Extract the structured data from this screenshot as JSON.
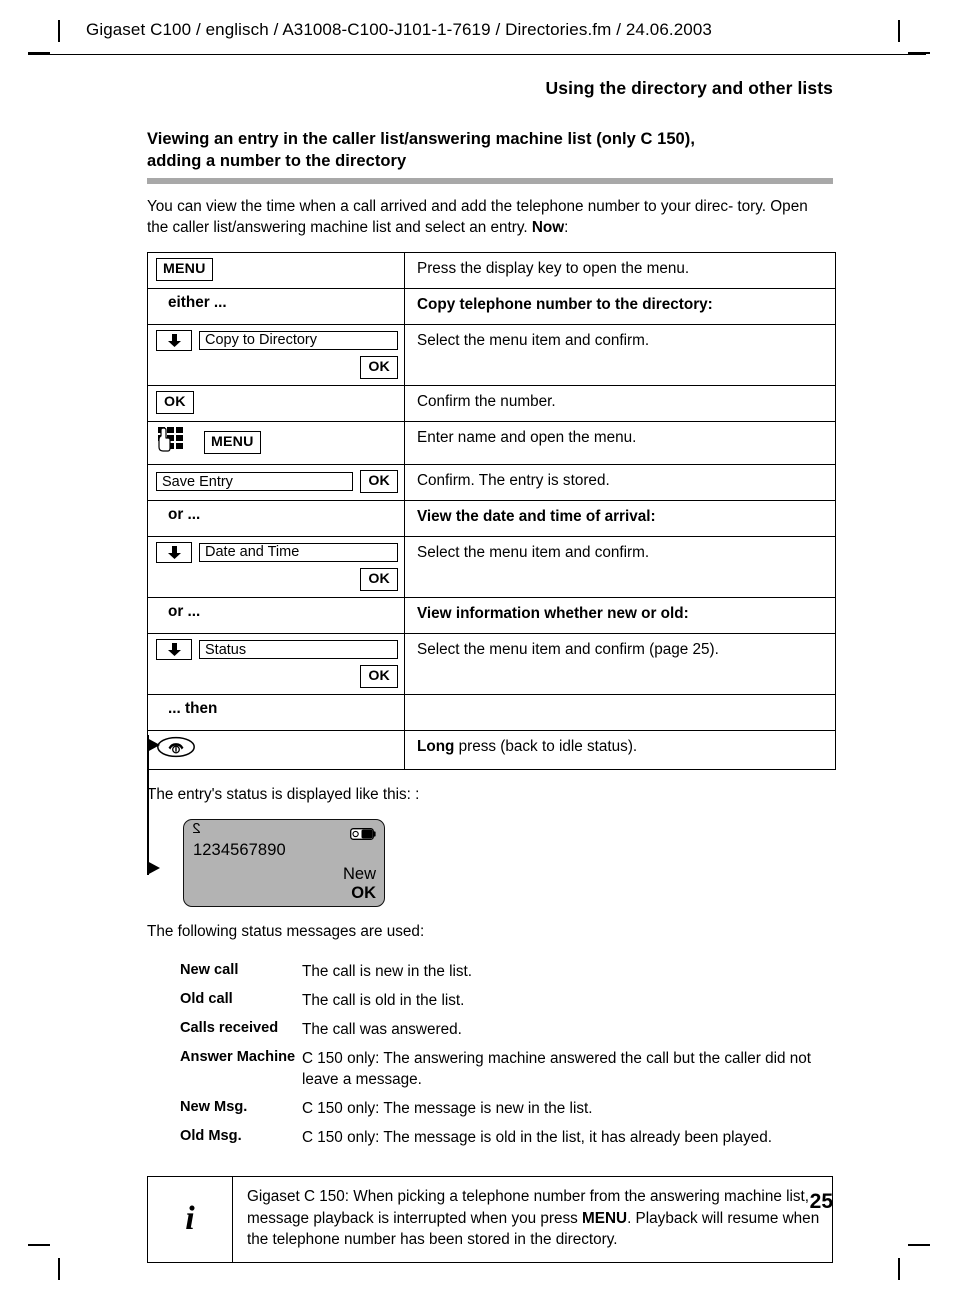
{
  "header": {
    "running_head": "Gigaset C100 / englisch / A31008-C100-J101-1-7619 / Directories.fm / 24.06.2003",
    "chapter_title": "Using the directory and other lists"
  },
  "section": {
    "title_line1": "Viewing an entry in the caller list/answering machine list (only C 150),",
    "title_line2": "adding a number to the directory",
    "intro_line1": "You can view the time when a call arrived and add the telephone number to your direc-",
    "intro_line2_a": "tory. Open the caller list/answering machine list and select an entry. ",
    "intro_line2_bold": "Now",
    "intro_line2_b": ":"
  },
  "procedure": {
    "rows": [
      {
        "kind": "key",
        "left_key": "MENU",
        "right": "Press the display key to open the menu.",
        "right_bold": false
      },
      {
        "kind": "lead",
        "left_lead": "either ...",
        "right": "Copy telephone number to the directory:",
        "right_bold": true
      },
      {
        "kind": "menuselect",
        "left_menu_label": "Copy to Directory",
        "left_ok": "OK",
        "right": "Select the menu item and confirm.",
        "right_bold": false
      },
      {
        "kind": "key",
        "left_key": "OK",
        "right": "Confirm the number.",
        "right_bold": false
      },
      {
        "kind": "keypad",
        "left_key": "MENU",
        "right": "Enter name and open the menu.",
        "right_bold": false
      },
      {
        "kind": "labelok",
        "left_menu_label": "Save Entry",
        "left_ok": "OK",
        "right": "Confirm. The entry is stored.",
        "right_bold": false
      },
      {
        "kind": "lead",
        "left_lead": "or ...",
        "right": "View the date and time of arrival:",
        "right_bold": true
      },
      {
        "kind": "menuselect",
        "left_menu_label": "Date and Time",
        "left_ok": "OK",
        "right": "Select the menu item and confirm.",
        "right_bold": false
      },
      {
        "kind": "lead",
        "left_lead": "or ...",
        "right": "View information whether new or old:",
        "right_bold": true
      },
      {
        "kind": "menuselect",
        "left_menu_label": "Status",
        "left_ok": "OK",
        "right": "Select the menu item and confirm (page 25).",
        "right_bold": false
      },
      {
        "kind": "lead",
        "left_lead": "... then",
        "right": "",
        "right_bold": false
      },
      {
        "kind": "hangup",
        "right_bold_prefix": "Long",
        "right": " press (back to idle status)."
      }
    ]
  },
  "display_intro": "The entry's status is displayed like this: :",
  "handset_display": {
    "antenna_symbol": "2",
    "number": "1234567890",
    "status": "New",
    "softkey": "OK",
    "bg_color": "#b3b3b3"
  },
  "status_intro": "The following status messages are used:",
  "status_messages": [
    {
      "term": "New call",
      "definition": "The call is new in the list."
    },
    {
      "term": "Old call",
      "definition": "The call is old in the list."
    },
    {
      "term": "Calls received",
      "definition": "The call was answered."
    },
    {
      "term": "Answer Machine",
      "definition": "C 150 only: The answering machine answered the call but the caller did not leave a message."
    },
    {
      "term": "New Msg.",
      "definition": "C 150 only: The message is new in the list."
    },
    {
      "term": "Old Msg.",
      "definition": "C 150 only: The message is old in the list, it has already been played."
    }
  ],
  "info_box": {
    "icon": "i",
    "text_a": "Gigaset C 150: When picking a telephone number from the answering machine list, message playback is interrupted when you press ",
    "text_bold": "MENU",
    "text_b": ". Playback will resume when the telephone number has been stored in the directory."
  },
  "folio": "25"
}
